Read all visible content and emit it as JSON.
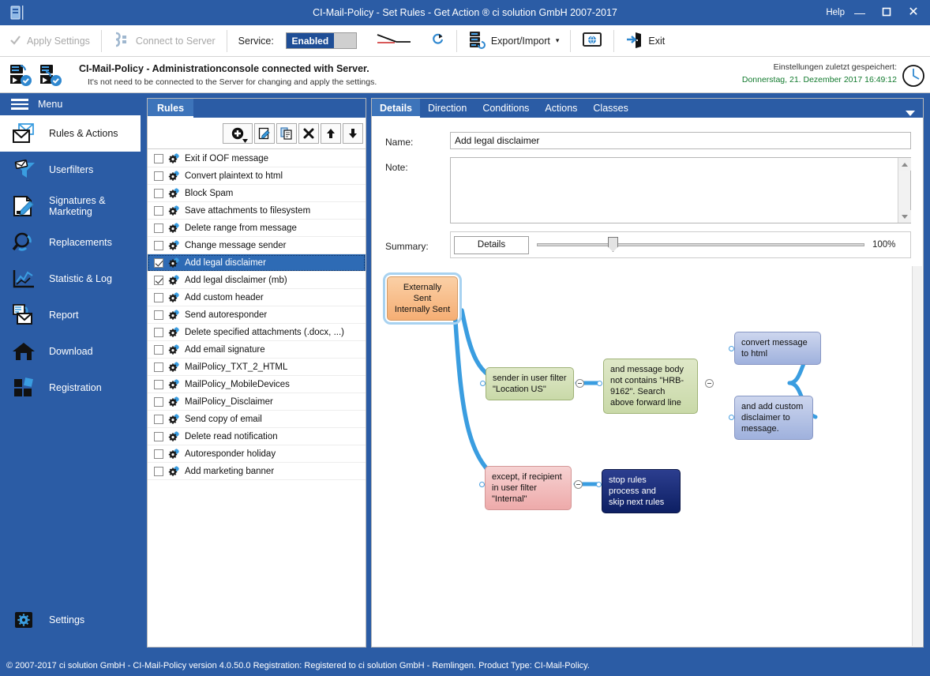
{
  "window": {
    "title": "CI-Mail-Policy - Set Rules - Get Action ® ci solution GmbH 2007-2017",
    "help_label": "Help",
    "minimize_glyph": "—",
    "maximize_glyph": "❐",
    "close_glyph": "✕",
    "accent_color": "#2b5ca5"
  },
  "toolbar": {
    "apply_settings": "Apply Settings",
    "connect_to_server": "Connect to Server",
    "service_label": "Service:",
    "service_state": "Enabled",
    "export_import": "Export/Import",
    "export_import_caret": "▾",
    "exit": "Exit"
  },
  "infobar": {
    "title": "CI-Mail-Policy - Administrationconsole connected with Server.",
    "subtitle": "It's not need to be connected to the Server for changing and apply the settings.",
    "saved_label": "Einstellungen zuletzt gespeichert:",
    "saved_date": "Donnerstag, 21. Dezember 2017 16:49:12",
    "saved_date_color": "#127a2e"
  },
  "sidebar": {
    "menu_label": "Menu",
    "items": [
      {
        "label": "Rules & Actions",
        "icon": "mail-envelope-icon",
        "active": true
      },
      {
        "label": "Userfilters",
        "icon": "funnel-filter-icon",
        "active": false
      },
      {
        "label": "Signatures & Marketing",
        "icon": "document-pencil-icon",
        "active": false
      },
      {
        "label": "Replacements",
        "icon": "magnifier-refresh-icon",
        "active": false
      },
      {
        "label": "Statistic & Log",
        "icon": "line-chart-icon",
        "active": false
      },
      {
        "label": "Report",
        "icon": "report-mail-icon",
        "active": false
      },
      {
        "label": "Download",
        "icon": "home-download-icon",
        "active": false
      },
      {
        "label": "Registration",
        "icon": "blocks-registration-icon",
        "active": false
      }
    ],
    "settings": {
      "label": "Settings",
      "icon": "gear-settings-icon"
    }
  },
  "rules_panel": {
    "tab_label": "Rules",
    "toolbar_buttons": [
      {
        "name": "add-rule-button",
        "glyph": "➕"
      },
      {
        "name": "edit-rule-button",
        "glyph": "✎"
      },
      {
        "name": "copy-rule-button",
        "glyph": "⧉"
      },
      {
        "name": "delete-rule-button",
        "glyph": "✖"
      },
      {
        "name": "move-up-button",
        "glyph": "↑"
      },
      {
        "name": "move-down-button",
        "glyph": "↓"
      }
    ],
    "rules": [
      {
        "label": "Exit if OOF message",
        "checked": false,
        "selected": false
      },
      {
        "label": "Convert plaintext to html",
        "checked": false,
        "selected": false
      },
      {
        "label": "Block Spam",
        "checked": false,
        "selected": false
      },
      {
        "label": "Save attachments to filesystem",
        "checked": false,
        "selected": false
      },
      {
        "label": "Delete range from message",
        "checked": false,
        "selected": false
      },
      {
        "label": "Change message sender",
        "checked": false,
        "selected": false
      },
      {
        "label": "Add legal disclaimer",
        "checked": true,
        "selected": true
      },
      {
        "label": "Add legal disclaimer (mb)",
        "checked": true,
        "selected": false
      },
      {
        "label": "Add custom header",
        "checked": false,
        "selected": false
      },
      {
        "label": "Send autoresponder",
        "checked": false,
        "selected": false
      },
      {
        "label": "Delete specified attachments (.docx, ...)",
        "checked": false,
        "selected": false
      },
      {
        "label": "Add email signature",
        "checked": false,
        "selected": false
      },
      {
        "label": "MailPolicy_TXT_2_HTML",
        "checked": false,
        "selected": false
      },
      {
        "label": "MailPolicy_MobileDevices",
        "checked": false,
        "selected": false
      },
      {
        "label": "MailPolicy_Disclaimer",
        "checked": false,
        "selected": false
      },
      {
        "label": "Send copy of email",
        "checked": false,
        "selected": false
      },
      {
        "label": "Delete read notification",
        "checked": false,
        "selected": false
      },
      {
        "label": "Autoresponder holiday",
        "checked": false,
        "selected": false
      },
      {
        "label": "Add marketing banner",
        "checked": false,
        "selected": false
      }
    ]
  },
  "details_panel": {
    "tabs": [
      {
        "label": "Details",
        "active": true
      },
      {
        "label": "Direction",
        "active": false
      },
      {
        "label": "Conditions",
        "active": false
      },
      {
        "label": "Actions",
        "active": false
      },
      {
        "label": "Classes",
        "active": false
      }
    ],
    "caret_glyph": "▼",
    "name_label": "Name:",
    "name_value": "Add legal disclaimer",
    "note_label": "Note:",
    "note_value": "",
    "summary_label": "Summary:",
    "details_button": "Details",
    "zoom_percent": "100%"
  },
  "diagram": {
    "nodes": [
      {
        "id": "root",
        "text": "Externally Sent\nInternally Sent",
        "style": "root"
      },
      {
        "id": "sender",
        "text": "sender in user filter\n\"Location US\"",
        "style": "green"
      },
      {
        "id": "body",
        "text": "and message body not contains \"HRB-9162\". Search above forward line",
        "style": "green"
      },
      {
        "id": "convert",
        "text": "convert message to html",
        "style": "blue"
      },
      {
        "id": "disclaimer",
        "text": "and add custom disclaimer to message.",
        "style": "blue"
      },
      {
        "id": "except",
        "text": "except, if recipient in user filter \"Internal\"",
        "style": "red"
      },
      {
        "id": "stop",
        "text": "stop rules process and skip next rules",
        "style": "navy"
      }
    ],
    "edge_color": "#3a9de0"
  },
  "footer": {
    "text": "© 2007-2017 ci solution GmbH - CI-Mail-Policy version 4.0.50.0 Registration: Registered to ci solution GmbH - Remlingen. Product Type: CI-Mail-Policy."
  }
}
